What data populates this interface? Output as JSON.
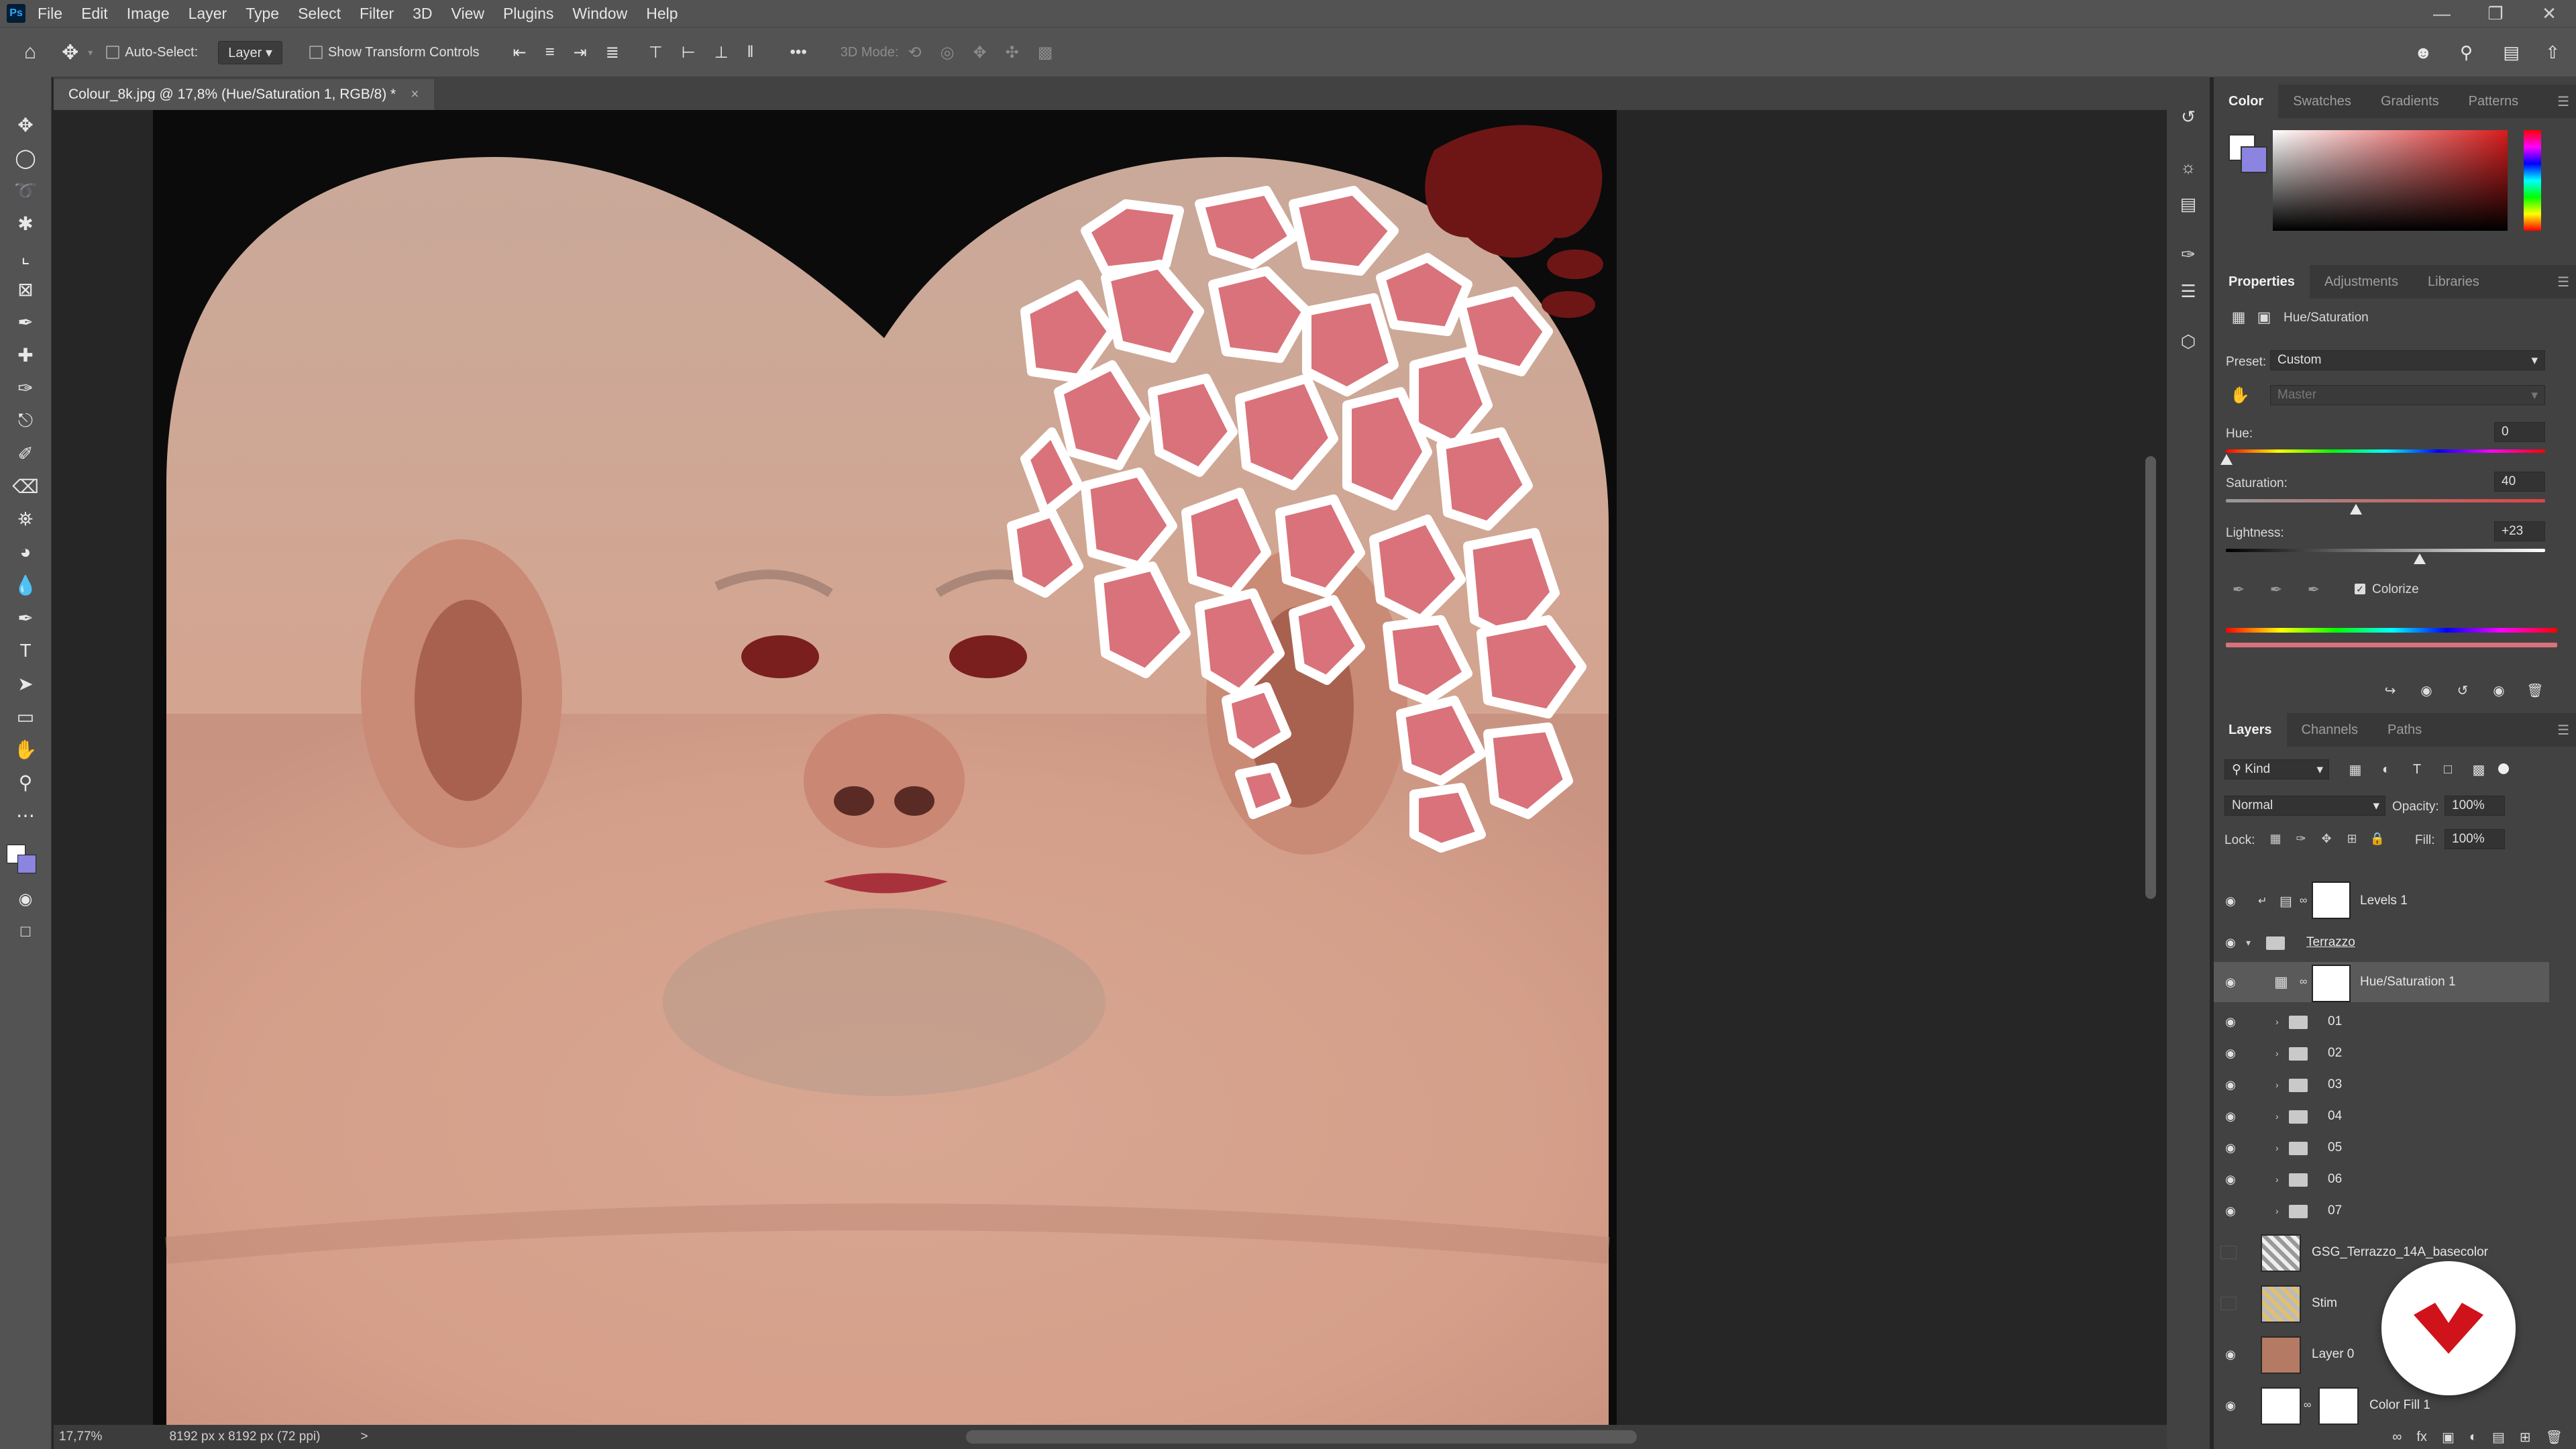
{
  "app": {
    "logo": "Ps"
  },
  "menu": [
    "File",
    "Edit",
    "Image",
    "Layer",
    "Type",
    "Select",
    "Filter",
    "3D",
    "View",
    "Plugins",
    "Window",
    "Help"
  ],
  "window_controls": [
    "minimize",
    "restore",
    "close"
  ],
  "options_bar": {
    "auto_select_label": "Auto-Select:",
    "auto_select_value": "Layer",
    "transform_label": "Show Transform Controls",
    "mode_3d_label": "3D Mode:",
    "more_label": "•••"
  },
  "document": {
    "tab_title": "Colour_8k.jpg @ 17,8% (Hue/Saturation 1, RGB/8) *",
    "close": "×"
  },
  "status": {
    "zoom": "17,77%",
    "doc_info": "8192 px x 8192 px (72 ppi)",
    "arrow": ">"
  },
  "color_panel": {
    "tabs": [
      "Color",
      "Swatches",
      "Gradients",
      "Patterns"
    ],
    "active_tab": "Color",
    "accent": "#d81c1c"
  },
  "properties_panel": {
    "tabs": [
      "Properties",
      "Adjustments",
      "Libraries"
    ],
    "active_tab": "Properties",
    "title": "Hue/Saturation",
    "preset_label": "Preset:",
    "preset_value": "Custom",
    "channel_value": "Master",
    "hue_label": "Hue:",
    "hue_value": "0",
    "saturation_label": "Saturation:",
    "saturation_value": "40",
    "lightness_label": "Lightness:",
    "lightness_value": "+23",
    "colorize_label": "Colorize",
    "colorize_checked": true
  },
  "layers_panel": {
    "tabs": [
      "Layers",
      "Channels",
      "Paths"
    ],
    "active_tab": "Layers",
    "filter_kind": "Kind",
    "blend_mode": "Normal",
    "opacity_label": "Opacity:",
    "opacity_value": "100%",
    "lock_label": "Lock:",
    "fill_label": "Fill:",
    "fill_value": "100%",
    "layers": [
      {
        "name": "Levels 1",
        "visible": true,
        "kind": "adjustment"
      },
      {
        "name": "Terrazzo",
        "visible": true,
        "kind": "group"
      },
      {
        "name": "Hue/Saturation 1",
        "visible": true,
        "kind": "adjustment-selected"
      },
      {
        "name": "01",
        "visible": true,
        "kind": "subgroup"
      },
      {
        "name": "02",
        "visible": true,
        "kind": "subgroup"
      },
      {
        "name": "03",
        "visible": true,
        "kind": "subgroup"
      },
      {
        "name": "04",
        "visible": true,
        "kind": "subgroup"
      },
      {
        "name": "05",
        "visible": true,
        "kind": "subgroup"
      },
      {
        "name": "06",
        "visible": true,
        "kind": "subgroup"
      },
      {
        "name": "07",
        "visible": true,
        "kind": "subgroup"
      },
      {
        "name": "GSG_Terrazzo_14A_basecolor",
        "visible": false,
        "kind": "image"
      },
      {
        "name": "Stim",
        "visible": false,
        "kind": "image"
      },
      {
        "name": "Layer 0",
        "visible": true,
        "kind": "image"
      },
      {
        "name": "Color Fill 1",
        "visible": true,
        "kind": "fill"
      }
    ]
  },
  "colors": {
    "ui_dark": "#262626",
    "ui_panel": "#424242",
    "ui_bar": "#535353",
    "skin": "#d9a48d",
    "terrazzo_pink": "#d9727a",
    "dark_red": "#6e1616",
    "watermark_red": "#d0121b"
  }
}
